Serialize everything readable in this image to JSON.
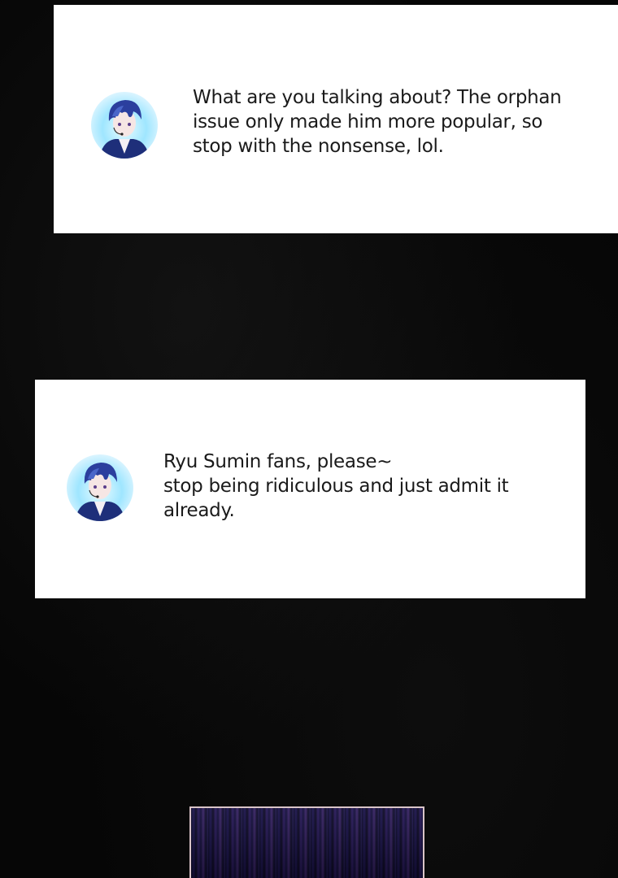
{
  "comments": [
    {
      "avatar_icon": "user-avatar-icon",
      "text": "What are you talking about? The orphan\nissue only made him more popular, so\nstop with the nonsense, lol."
    },
    {
      "avatar_icon": "user-avatar-icon",
      "text": "Ryu Sumin fans, please~\nstop being ridiculous and just admit it\nalready."
    }
  ],
  "colors": {
    "background": "#050505",
    "card": "#ffffff",
    "text": "#1a1a1a",
    "hair": "#2b3f9e",
    "avatar_glow": "#9fe6ff",
    "panel_border": "#d9c4c8"
  }
}
